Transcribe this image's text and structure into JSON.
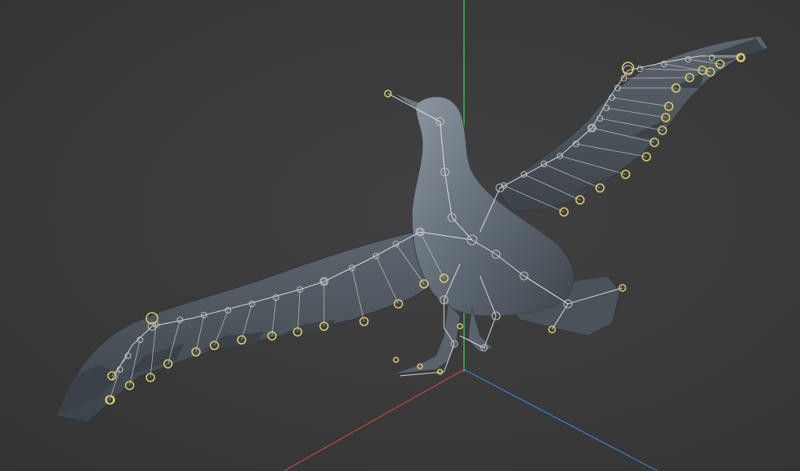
{
  "colors": {
    "background": "#3b3b3b",
    "axis_y": "#3fbf5a",
    "axis_x": "#c9463f",
    "axis_z": "#3d7fd0",
    "body": "#5f6872",
    "feather": "#4a525a",
    "bone": "#e8e8e8",
    "joint_ring": "#bdbdbd",
    "tip_ring": "#d9c86a"
  },
  "icons": {
    "bird": "seagull-mesh",
    "rig": "bone-joint-rig"
  }
}
